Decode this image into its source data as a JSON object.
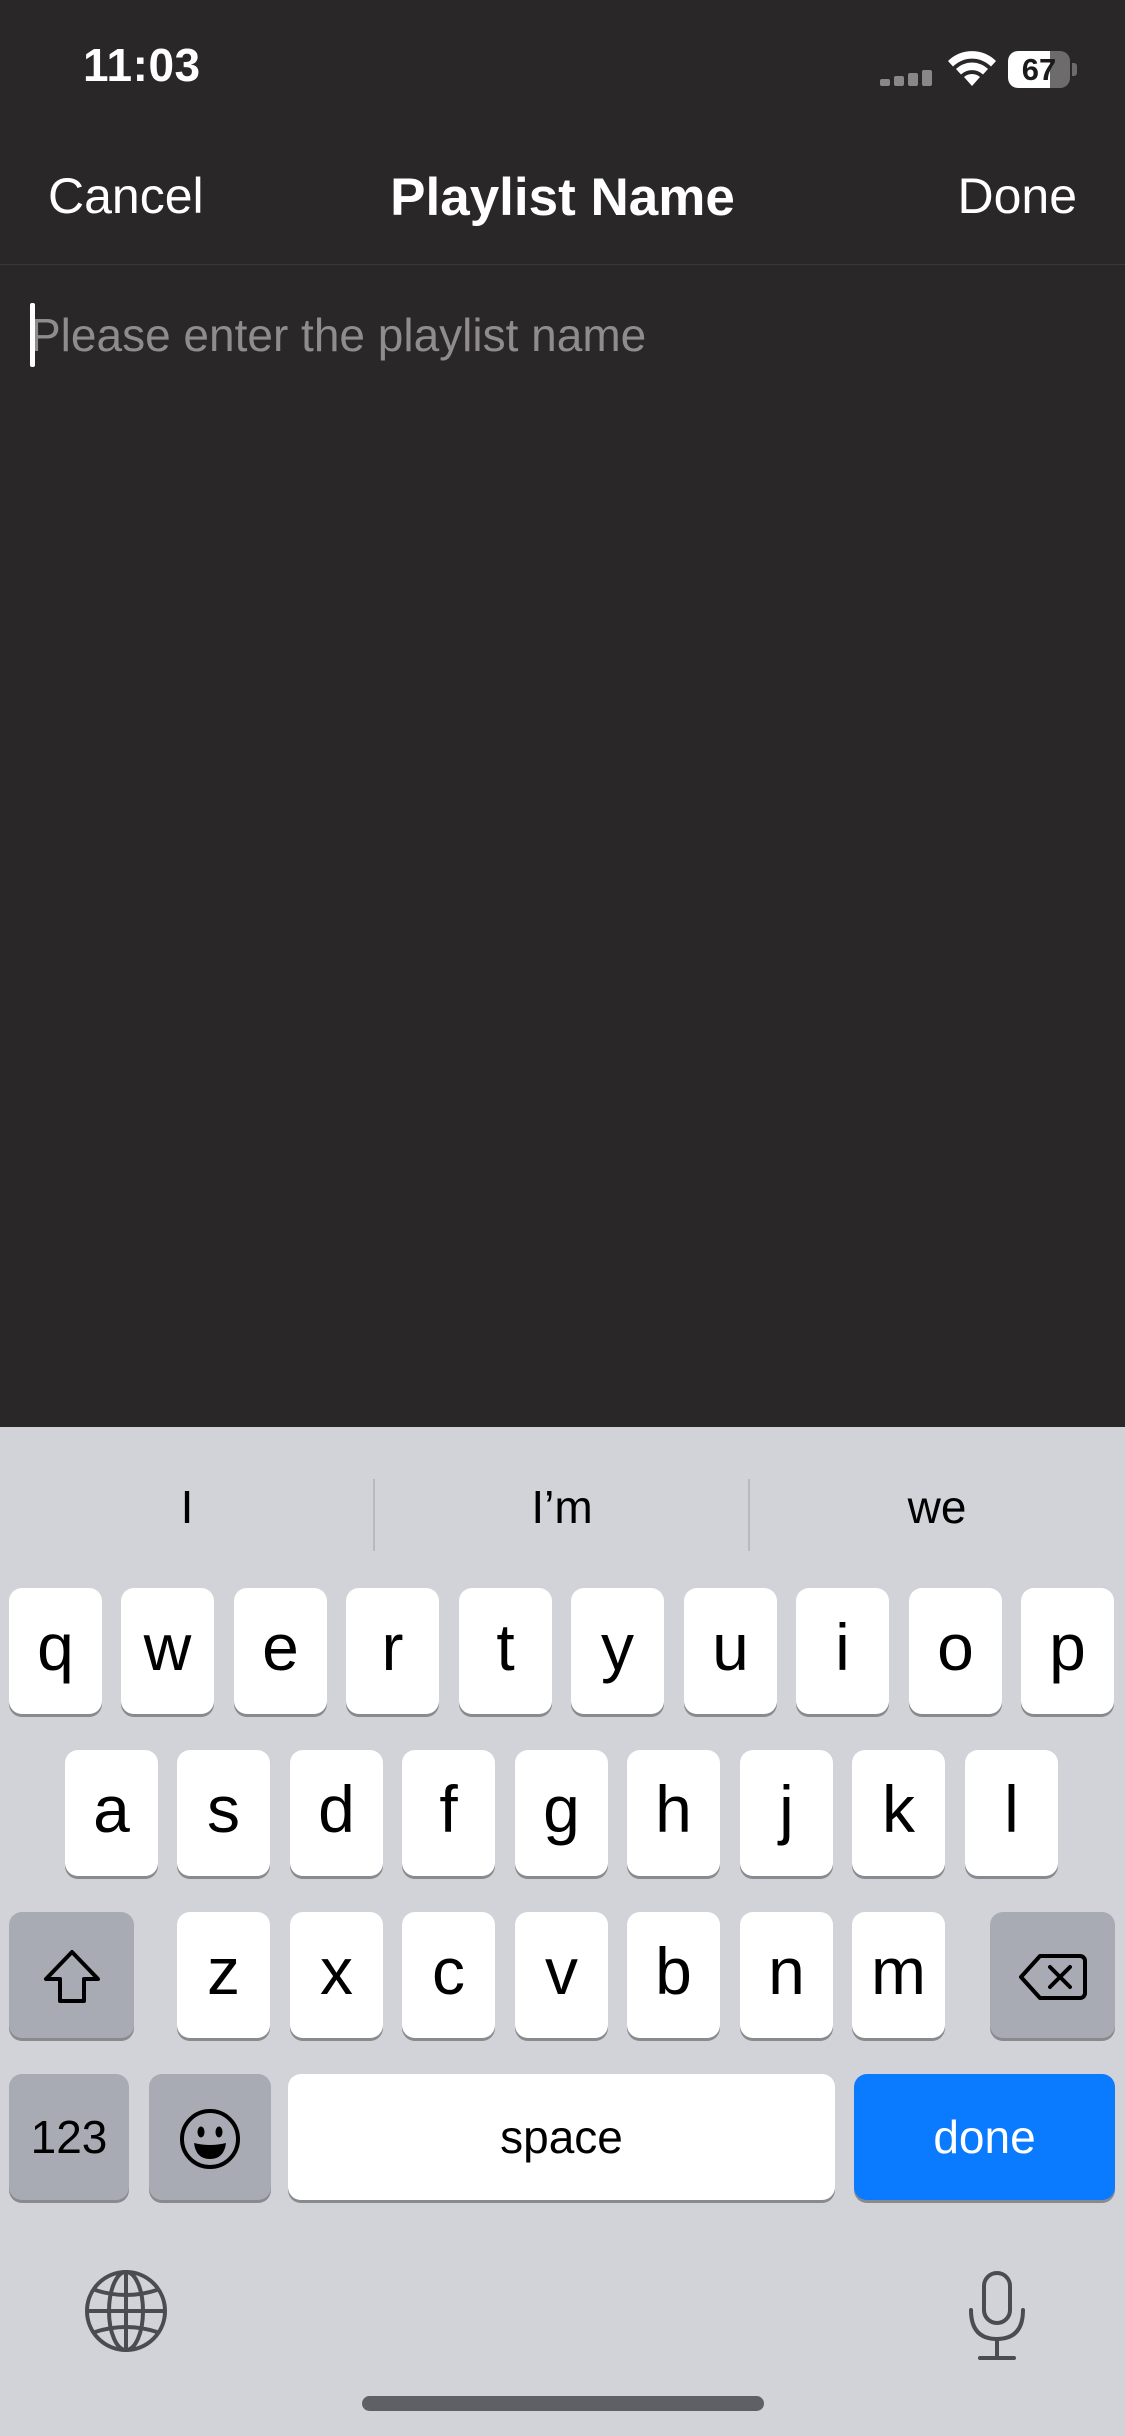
{
  "status_bar": {
    "time": "11:03",
    "battery_percent": "67",
    "battery_level": 0.67,
    "signal_icon": "cellular-signal-icon",
    "wifi_icon": "wifi-icon"
  },
  "nav": {
    "cancel_label": "Cancel",
    "title": "Playlist Name",
    "done_label": "Done"
  },
  "input": {
    "value": "",
    "placeholder": "Please enter the playlist name"
  },
  "keyboard": {
    "suggestions": [
      "I",
      "I’m",
      "we"
    ],
    "row1": [
      "q",
      "w",
      "e",
      "r",
      "t",
      "y",
      "u",
      "i",
      "o",
      "p"
    ],
    "row2": [
      "a",
      "s",
      "d",
      "f",
      "g",
      "h",
      "j",
      "k",
      "l"
    ],
    "row3": [
      "z",
      "x",
      "c",
      "v",
      "b",
      "n",
      "m"
    ],
    "numbers_label": "123",
    "space_label": "space",
    "done_label": "done",
    "shift_icon": "shift-icon",
    "delete_icon": "delete-icon",
    "emoji_icon": "emoji-icon",
    "globe_icon": "globe-icon",
    "mic_icon": "microphone-icon"
  },
  "colors": {
    "background": "#2a2729",
    "keyboard_background": "#d1d3d9",
    "accent_done_key": "#0a7aff"
  }
}
